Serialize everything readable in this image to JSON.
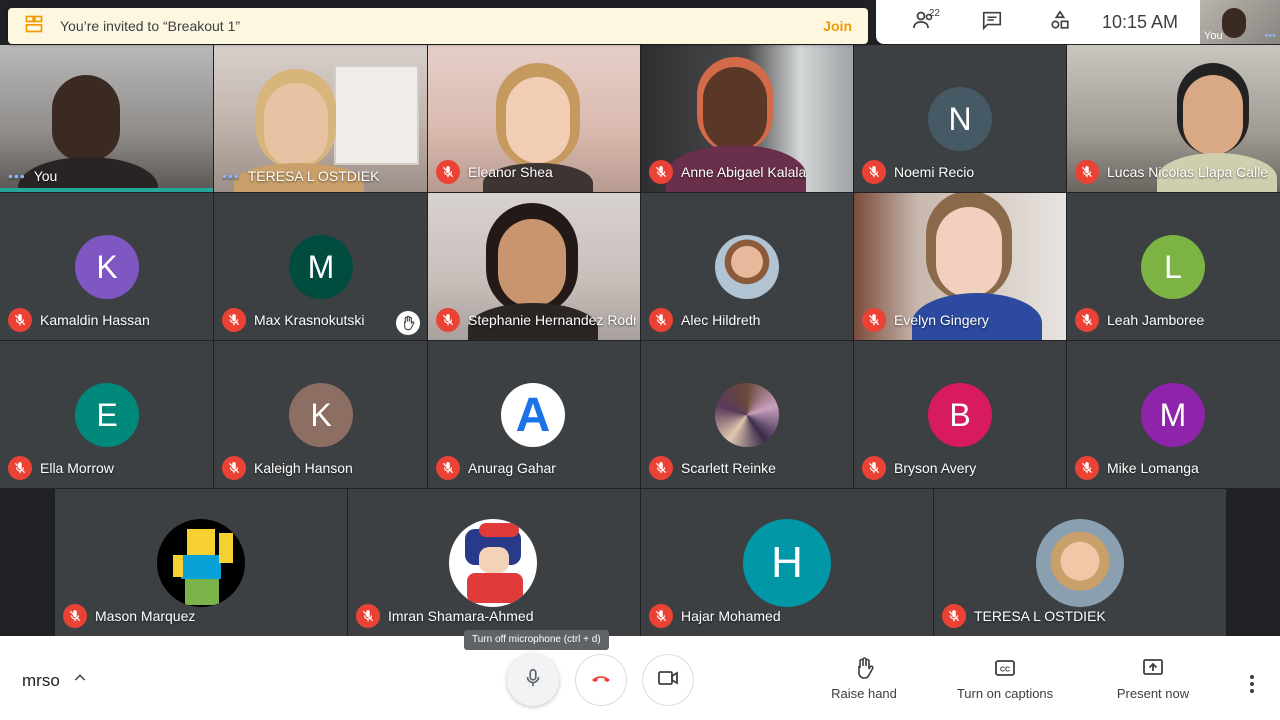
{
  "banner": {
    "text": "You’re invited to “Breakout 1”",
    "join_label": "Join"
  },
  "topbar": {
    "participant_count": "22",
    "time": "10:15 AM",
    "self_label": "You"
  },
  "row1": [
    {
      "name": "You",
      "indicator": "dots",
      "video": true
    },
    {
      "name": "TERESA L OSTDIEK",
      "indicator": "dots",
      "video": true
    },
    {
      "name": "Eleanor Shea",
      "indicator": "mic-off",
      "video": true
    },
    {
      "name": "Anne Abigael Kalala",
      "indicator": "mic-off",
      "video": true
    },
    {
      "name": "Noemi Recio",
      "indicator": "mic-off",
      "initial": "N",
      "color": "#455a64"
    },
    {
      "name": "Lucas Nicolas Llapa Calle",
      "indicator": "mic-off",
      "video": true
    }
  ],
  "row2": [
    {
      "name": "Kamaldin Hassan",
      "initial": "K",
      "color": "#7e57c2"
    },
    {
      "name": "Max Krasnokutski",
      "initial": "M",
      "color": "#004d40",
      "hand_raised": true
    },
    {
      "name": "Stephanie Hernandez Rodr...",
      "video": true
    },
    {
      "name": "Alec Hildreth",
      "photo": true
    },
    {
      "name": "Evelyn Gingery",
      "video": true
    },
    {
      "name": "Leah Jamboree",
      "initial": "L",
      "color": "#7cb342"
    }
  ],
  "row3": [
    {
      "name": "Ella Morrow",
      "initial": "E",
      "color": "#00897b"
    },
    {
      "name": "Kaleigh Hanson",
      "initial": "K",
      "color": "#8d6e63"
    },
    {
      "name": "Anurag Gahar",
      "initial": "A",
      "color": "#ffffff",
      "glyph_color": "#1a73e8"
    },
    {
      "name": "Scarlett Reinke",
      "photo": true
    },
    {
      "name": "Bryson Avery",
      "initial": "B",
      "color": "#d81b60"
    },
    {
      "name": "Mike Lomanga",
      "initial": "M",
      "color": "#8e24aa"
    }
  ],
  "row4": [
    {
      "name": "Mason Marquez",
      "photo": true
    },
    {
      "name": "Imran Shamara-Ahmed",
      "photo": true
    },
    {
      "name": "Hajar Mohamed",
      "initial": "H",
      "color": "#0097a7"
    },
    {
      "name": "TERESA L OSTDIEK",
      "photo": true
    }
  ],
  "bottom": {
    "meeting_code": "mrso",
    "tooltip": "Turn off microphone (ctrl + d)",
    "raise_hand": "Raise hand",
    "captions": "Turn on captions",
    "present": "Present now"
  },
  "colors": {
    "mic_off": "#ea4335",
    "join": "#f29900",
    "hangup": "#ea4335"
  }
}
